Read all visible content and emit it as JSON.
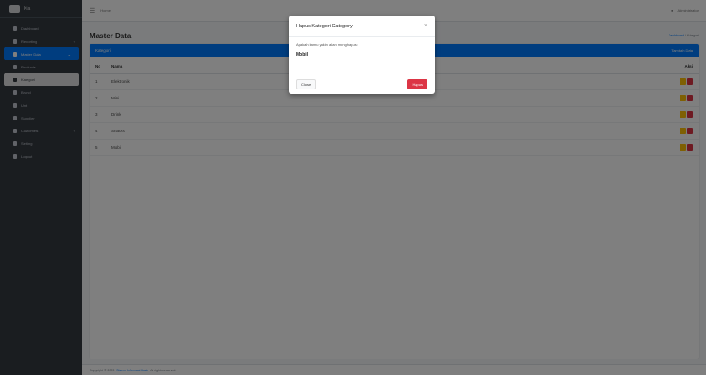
{
  "brand": {
    "name": "Kia",
    "logo_icon": "logo-icon"
  },
  "sidebar": {
    "items": [
      {
        "label": "Dashboard",
        "icon": "dashboard-icon"
      },
      {
        "label": "Reporting",
        "icon": "chart-icon"
      },
      {
        "label": "Master Data",
        "icon": "database-icon",
        "state": "active"
      },
      {
        "label": "Products",
        "icon": "box-icon"
      },
      {
        "label": "Kategori",
        "icon": "tag-icon",
        "state": "sub-active"
      },
      {
        "label": "Brand",
        "icon": "circle-icon"
      },
      {
        "label": "Unit",
        "icon": "circle-icon"
      },
      {
        "label": "Supplier",
        "icon": "truck-icon"
      },
      {
        "label": "Customers",
        "icon": "users-icon"
      },
      {
        "label": "Setting",
        "icon": "gear-icon"
      },
      {
        "label": "Logout",
        "icon": "logout-icon"
      }
    ]
  },
  "topbar": {
    "home_link": "Home",
    "user": "Administrator"
  },
  "page": {
    "title": "Master Data",
    "breadcrumb_home": "Dashboard",
    "breadcrumb_current": "Kategori"
  },
  "card": {
    "title": "Kategori",
    "tool": "Tambah Data"
  },
  "table": {
    "columns": [
      "No",
      "Nama",
      "Aksi"
    ],
    "rows": [
      {
        "no": "1",
        "name": "Elektronik"
      },
      {
        "no": "2",
        "name": "Mini"
      },
      {
        "no": "3",
        "name": "Drink"
      },
      {
        "no": "4",
        "name": "Snacks"
      },
      {
        "no": "5",
        "name": "Mobil"
      }
    ]
  },
  "footer": {
    "prefix": "Copyright © 2023",
    "link": "Sistem Informasi Kasir",
    "suffix": "All rights reserved."
  },
  "modal": {
    "title": "Hapus Kategori Category",
    "question": "Apakah kamu yakin akan menghapus:",
    "item": "Mobil",
    "close_label": "Close",
    "delete_label": "Hapus"
  }
}
